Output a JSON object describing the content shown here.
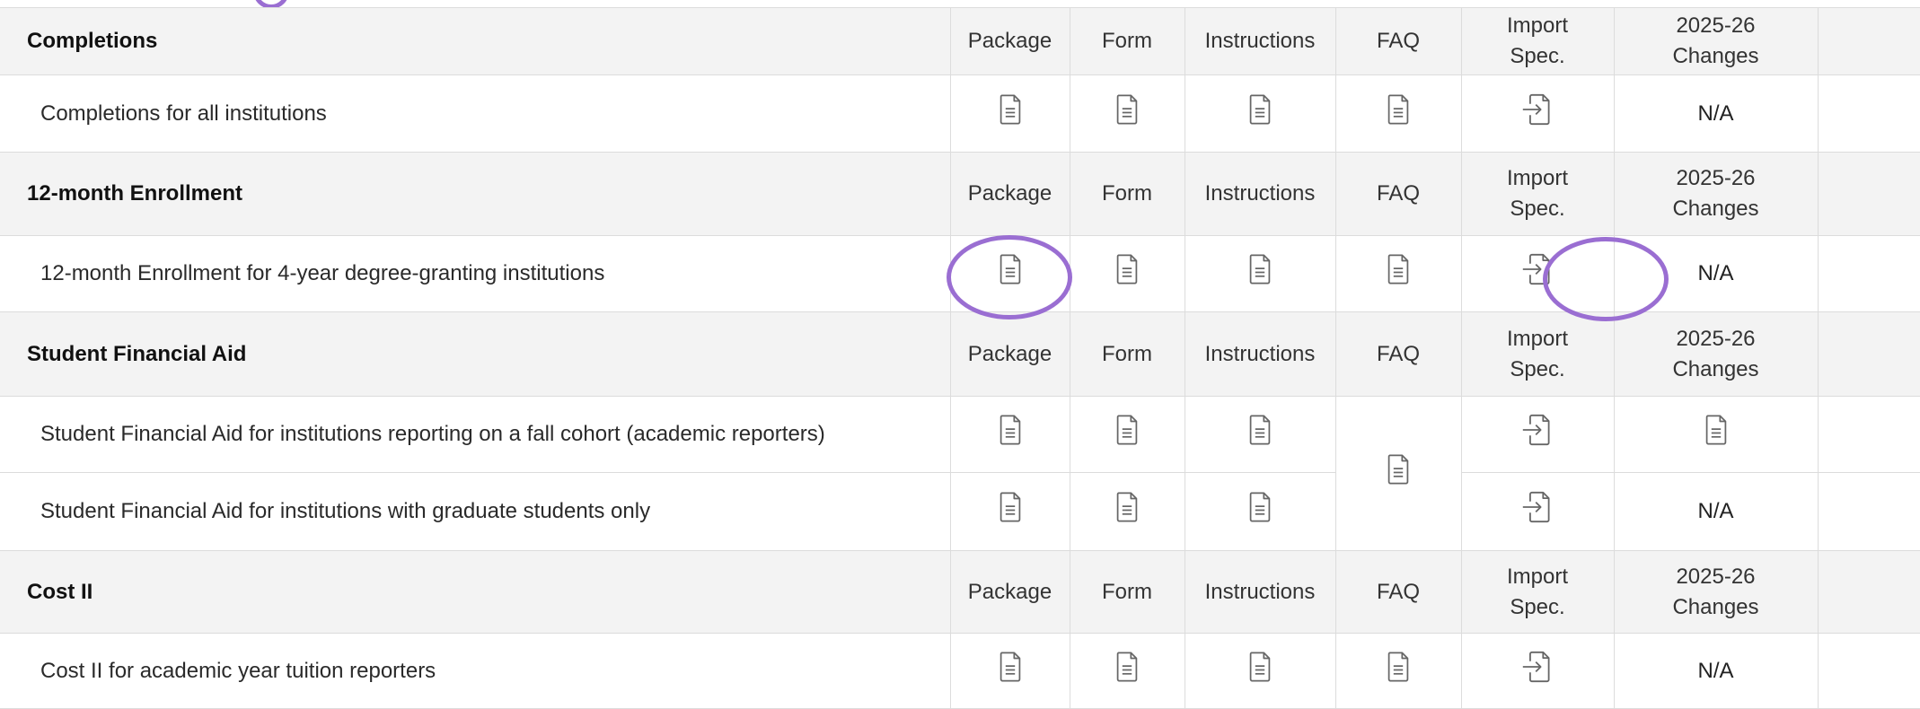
{
  "sections": [
    {
      "title": "Completions",
      "headers": {
        "package": "Package",
        "form": "Form",
        "instructions": "Instructions",
        "faq": "FAQ",
        "import_l1": "Import",
        "import_l2": "Spec.",
        "changes_l1": "2025-26",
        "changes_l2": "Changes"
      },
      "rows": [
        {
          "label": "Completions for all institutions",
          "changes": "N/A"
        }
      ]
    },
    {
      "title": "12-month Enrollment",
      "headers": {
        "package": "Package",
        "form": "Form",
        "instructions": "Instructions",
        "faq": "FAQ",
        "import_l1": "Import",
        "import_l2": "Spec.",
        "changes_l1": "2025-26",
        "changes_l2": "Changes"
      },
      "rows": [
        {
          "label": "12-month Enrollment for 4-year degree-granting institutions",
          "changes": "N/A"
        }
      ]
    },
    {
      "title": "Student Financial Aid",
      "headers": {
        "package": "Package",
        "form": "Form",
        "instructions": "Instructions",
        "faq": "FAQ",
        "import_l1": "Import",
        "import_l2": "Spec.",
        "changes_l1": "2025-26",
        "changes_l2": "Changes"
      },
      "rows": [
        {
          "label": "Student Financial Aid for institutions reporting on a fall cohort (academic reporters)",
          "changes": null
        },
        {
          "label": "Student Financial Aid for institutions with graduate students only",
          "changes": "N/A"
        }
      ]
    },
    {
      "title": "Cost II",
      "headers": {
        "package": "Package",
        "form": "Form",
        "instructions": "Instructions",
        "faq": "FAQ",
        "import_l1": "Import",
        "import_l2": "Spec.",
        "changes_l1": "2025-26",
        "changes_l2": "Changes"
      },
      "rows": [
        {
          "label": "Cost II for academic year tuition reporters",
          "changes": "N/A"
        }
      ]
    }
  ],
  "icons": {
    "document": "document-icon",
    "import": "import-spec-icon"
  },
  "colors": {
    "highlight": "#9a6ed2",
    "header_bg": "#f3f3f3",
    "border": "#dcdcdc",
    "icon_stroke": "#666666"
  }
}
